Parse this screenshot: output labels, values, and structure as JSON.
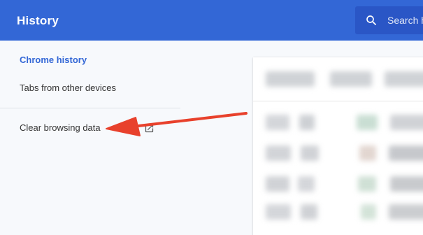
{
  "header": {
    "title": "History",
    "search_placeholder": "Search h",
    "search_icon": "search-icon"
  },
  "sidebar": {
    "items": [
      {
        "label": "Chrome history",
        "active": true
      },
      {
        "label": "Tabs from other devices",
        "active": false
      },
      {
        "label": "Clear browsing data",
        "active": false,
        "icon": "external-link-icon"
      }
    ]
  },
  "annotation": {
    "color": "#e8412c"
  },
  "colors": {
    "header": "#3367d6",
    "accent": "#3367d6",
    "background": "#f7f9fc"
  }
}
